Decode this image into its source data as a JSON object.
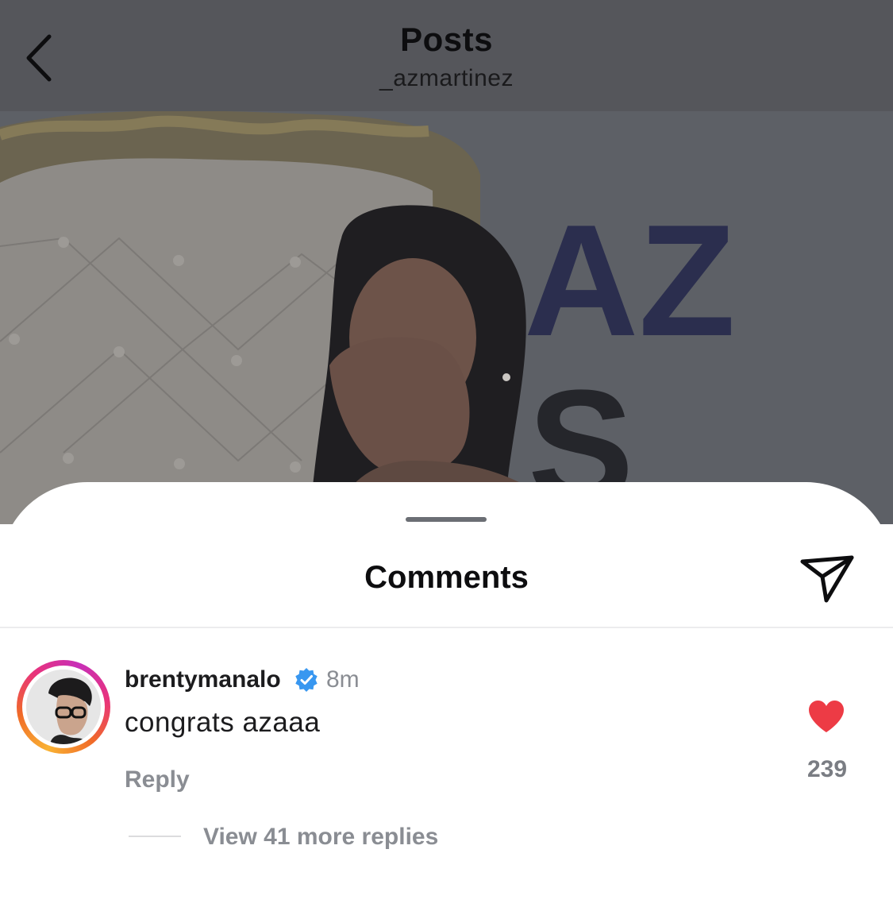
{
  "header": {
    "title": "Posts",
    "subtitle": "_azmartinez",
    "back_icon": "chevron-left-icon"
  },
  "photo": {
    "sign_letters_row1": "AZ",
    "sign_letters_row2": "S"
  },
  "sheet": {
    "title": "Comments",
    "share_icon": "send-icon"
  },
  "comment": {
    "username": "brentymanalo",
    "verified": true,
    "time": "8m",
    "text": "congrats azaaa",
    "reply_label": "Reply",
    "like_count": "239",
    "liked": true,
    "like_color": "#ed3b45",
    "view_replies_label": "View 41 more replies"
  },
  "colors": {
    "verified_badge": "#3897f0",
    "header_dim": "#55565b"
  }
}
